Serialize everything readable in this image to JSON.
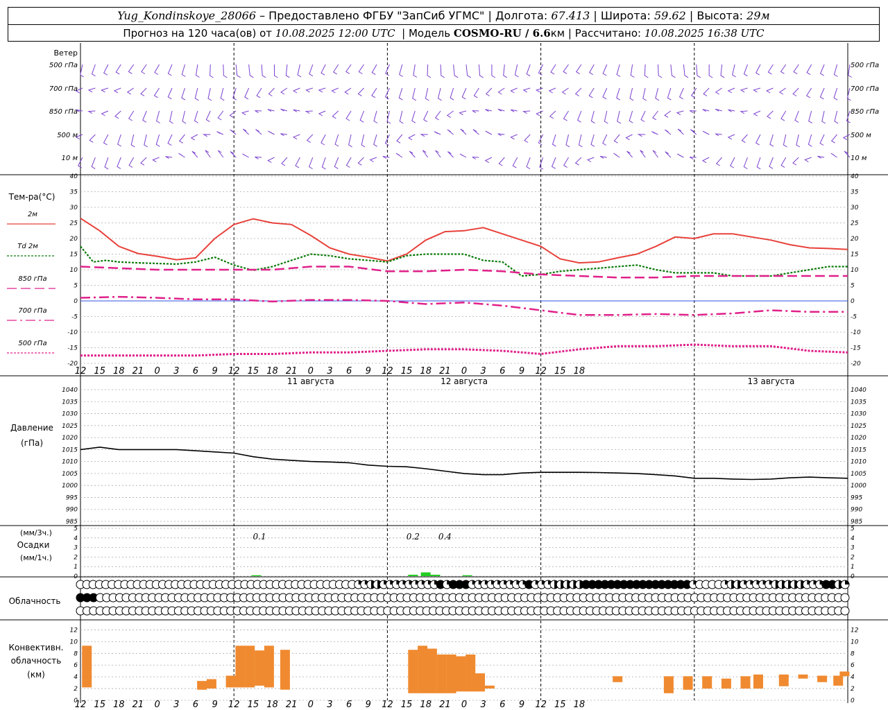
{
  "header": {
    "station": "Yug_Kondinskoye_28066",
    "provider": "– Предоставлено ФГБУ \"ЗапСиб УГМС\"",
    "lon_label": "Долгота:",
    "lon": "67.413",
    "lat_label": "Широта:",
    "lat": "59.62",
    "alt_label": "Высота:",
    "alt": "29м",
    "forecast_label": "Прогноз на 120 часа(ов) от",
    "forecast_start": "10.08.2025 12:00 UTC",
    "model_label": "Модель",
    "model": "COSMO-RU / 6.6",
    "model_unit": "км",
    "calc_label": "Рассчитано:",
    "calc_time": "10.08.2025 16:38 UTC"
  },
  "colors": {
    "wind": "#7a3fd0",
    "t2m": "#e8413a",
    "td2m": "#0a7a0a",
    "t850": "#e0208a",
    "t700": "#e0208a",
    "t500": "#e0208a",
    "precip": "#22cc22",
    "conv": "#f08a30",
    "pressure": "#000000"
  },
  "labels": {
    "wind_title": "Ветер",
    "wind_levels": [
      "500 гПа",
      "700 гПа",
      "850 гПа",
      "500 м",
      "10  м"
    ],
    "temp_title": "Тем-ра(°C)",
    "legend": [
      {
        "label": "2м"
      },
      {
        "label": "Td  2м"
      },
      {
        "label": "850 гПа"
      },
      {
        "label": "700 гПа"
      },
      {
        "label": "500 гПа"
      }
    ],
    "pressure_title": "Давление",
    "pressure_unit": "(гПа)",
    "precip_unit1": "(мм/3ч.)",
    "precip_title": "Осадки",
    "precip_unit2": "(мм/1ч.)",
    "cloud_title": "Облачность",
    "conv_title1": "Конвективн.",
    "conv_title2": "облачность",
    "conv_unit": "(км)"
  },
  "chart_data": {
    "type": "line",
    "x_hours": [
      12,
      15,
      18,
      21,
      0,
      3,
      6,
      9,
      12,
      15,
      18,
      21,
      0,
      3,
      6,
      9,
      12,
      15,
      18,
      21,
      0,
      3,
      6,
      9,
      12,
      15,
      18
    ],
    "dates": [
      "11 августа",
      "12 августа",
      "13 августа"
    ],
    "temperature": {
      "ylim": [
        -20,
        40
      ],
      "ticks": [
        40,
        35,
        30,
        25,
        20,
        15,
        10,
        5,
        0,
        -5,
        -10,
        -15,
        -20
      ],
      "series": [
        {
          "name": "2м",
          "x": [
            0,
            3,
            6,
            9,
            12,
            15,
            18,
            21,
            24,
            27,
            30,
            33,
            36,
            39,
            42,
            45,
            48,
            51,
            54,
            57,
            60,
            63,
            66,
            69,
            72,
            75,
            78,
            81,
            84,
            87,
            90,
            93,
            96,
            99,
            102,
            105,
            108,
            111,
            114,
            117,
            120
          ],
          "values": [
            26.5,
            22.5,
            17.5,
            15.2,
            14.3,
            13.2,
            13.8,
            20,
            24.5,
            26.3,
            25,
            24.5,
            21,
            17,
            15,
            14,
            12.8,
            15,
            19.5,
            22.2,
            22.5,
            23.5,
            21.5,
            19.5,
            17.5,
            13.5,
            12.2,
            12.5,
            13.8,
            15,
            17.5,
            20.5,
            20,
            21.5,
            21.5,
            20.5,
            19.5,
            18,
            17,
            16.8,
            16.5
          ]
        },
        {
          "name": "Td  2м",
          "x": [
            0,
            2,
            4,
            6,
            9,
            12,
            15,
            18,
            21,
            24,
            27,
            30,
            33,
            36,
            39,
            42,
            45,
            48,
            51,
            54,
            57,
            60,
            63,
            66,
            69,
            72,
            75,
            78,
            81,
            84,
            87,
            90,
            93,
            96,
            99,
            102,
            105,
            108,
            111,
            114,
            117,
            120
          ],
          "values": [
            17.5,
            12.5,
            13,
            12.5,
            12.2,
            12,
            11.8,
            12.5,
            14,
            11.5,
            9.8,
            11,
            13,
            15,
            14.5,
            13.5,
            13,
            12.5,
            14.5,
            15,
            15,
            15,
            13,
            12.5,
            8,
            8.5,
            9.5,
            10,
            10.5,
            11,
            11.5,
            10,
            9,
            9,
            9,
            8,
            8,
            8,
            9,
            10,
            11,
            11
          ]
        },
        {
          "name": "850 гПа",
          "x": [
            0,
            6,
            12,
            18,
            24,
            30,
            36,
            42,
            48,
            54,
            60,
            66,
            72,
            78,
            84,
            90,
            96,
            102,
            108,
            114,
            120
          ],
          "values": [
            11,
            10.5,
            10,
            10,
            10,
            10,
            11,
            11,
            9.5,
            9.5,
            10,
            9.5,
            8.5,
            8,
            7.5,
            7.5,
            8,
            8,
            8,
            8,
            8
          ]
        },
        {
          "name": "700 гПа",
          "x": [
            0,
            6,
            12,
            18,
            24,
            30,
            36,
            42,
            48,
            54,
            60,
            66,
            72,
            78,
            84,
            90,
            96,
            102,
            108,
            114,
            120
          ],
          "values": [
            1,
            1.3,
            1,
            0.5,
            0.5,
            -0.2,
            0.3,
            0.3,
            0,
            -1,
            -0.5,
            -1.5,
            -3,
            -4.5,
            -4.5,
            -4.2,
            -4.5,
            -4,
            -3,
            -3.5,
            -3.5
          ]
        },
        {
          "name": "500 гПа",
          "x": [
            0,
            6,
            12,
            18,
            24,
            30,
            36,
            42,
            48,
            54,
            60,
            66,
            72,
            78,
            84,
            90,
            96,
            102,
            108,
            114,
            120
          ],
          "values": [
            -17.5,
            -17.5,
            -17.5,
            -17.5,
            -17,
            -17,
            -16.5,
            -16.5,
            -16,
            -15.5,
            -15.5,
            -16,
            -17,
            -15.5,
            -14.5,
            -14.5,
            -14,
            -14.5,
            -14.5,
            -16,
            -16.5
          ]
        }
      ]
    },
    "pressure": {
      "ylim": [
        985,
        1040
      ],
      "ticks": [
        1040,
        1035,
        1030,
        1025,
        1020,
        1015,
        1010,
        1005,
        1000,
        995,
        990,
        985
      ],
      "x": [
        0,
        3,
        6,
        9,
        12,
        15,
        18,
        21,
        24,
        27,
        30,
        33,
        36,
        39,
        42,
        45,
        48,
        51,
        54,
        57,
        60,
        63,
        66,
        69,
        72,
        75,
        78,
        81,
        84,
        87,
        90,
        93,
        96,
        99,
        102,
        105,
        108,
        111,
        114,
        117,
        120
      ],
      "values": [
        1015,
        1016,
        1015,
        1015,
        1015,
        1015,
        1014.5,
        1014,
        1013.5,
        1012,
        1011,
        1010.5,
        1010,
        1009.8,
        1009.5,
        1008.5,
        1008,
        1007.8,
        1007,
        1006,
        1005,
        1004.5,
        1004.5,
        1005.2,
        1005.5,
        1005.5,
        1005.5,
        1005.4,
        1005.2,
        1005,
        1004.5,
        1004,
        1003,
        1003,
        1002.7,
        1002.5,
        1002.7,
        1003.2,
        1003.5,
        1003.2,
        1003
      ]
    },
    "precip": {
      "ylim": [
        0,
        5
      ],
      "ticks": [
        5,
        4,
        3,
        2,
        1,
        0
      ],
      "labels": [
        {
          "x": 28,
          "text": "0.1"
        },
        {
          "x": 52,
          "text": "0.2"
        },
        {
          "x": 57,
          "text": "0.4"
        }
      ],
      "bars": [
        {
          "x": 27.5,
          "value": 0.1
        },
        {
          "x": 52,
          "value": 0.15
        },
        {
          "x": 54,
          "value": 0.4
        },
        {
          "x": 55.5,
          "value": 0.15
        },
        {
          "x": 60.5,
          "value": 0.1
        }
      ]
    },
    "cloud_rows": [
      "OOOOOOOOOOOOOOOOOOOOOOOOOOOOOOOOOOOOOOOOOOOOQQTTQQQQQQQQQHQHHHQQQQQQQQQHQQQTTTTTHHHHHHHHHHHHHHHHHQOOOOQTTQQQQQTTTTTQQQHHTQ",
      "HHHOOOOOOOOOOOOOOOOOOOOOOOOOOOOOOOOOOOOOOOOOOOOOOOOOOOOOOOOOOOOOOOOOOOOOOOOOOOOOOOOOOOOOOOOOOOOOOOOOOOOOOOOOOOOOOOOOOO",
      "OOOOOOOOOOOOOOOOOOOOOOOOOOOOOOOOOOOOOOOOOOOOOOOOOOOOOOOOOOOOOOOOOOOOOOOOOOOOOOOOOOOOOOOOOOOOOOOOOOOOOOOOOOOOOOOOOOOOOO"
    ],
    "convective": {
      "ylim": [
        0,
        13
      ],
      "ticks": [
        12,
        10,
        8,
        6,
        4,
        2,
        0
      ],
      "bars": [
        {
          "x": 1,
          "base": 2.2,
          "top": 9.3
        },
        {
          "x": 19,
          "base": 1.8,
          "top": 3.3
        },
        {
          "x": 20.5,
          "base": 2.0,
          "top": 3.6
        },
        {
          "x": 23.5,
          "base": 2.2,
          "top": 4.2
        },
        {
          "x": 25,
          "base": 2.2,
          "top": 9.3
        },
        {
          "x": 26.5,
          "base": 2.2,
          "top": 9.3
        },
        {
          "x": 28,
          "base": 2.5,
          "top": 8.5
        },
        {
          "x": 29.5,
          "base": 2.2,
          "top": 9.3
        },
        {
          "x": 32,
          "base": 1.8,
          "top": 8.6
        },
        {
          "x": 52,
          "base": 1.2,
          "top": 8.6
        },
        {
          "x": 53.5,
          "base": 1.2,
          "top": 9.3
        },
        {
          "x": 55,
          "base": 1.2,
          "top": 8.8
        },
        {
          "x": 56.5,
          "base": 1.2,
          "top": 7.8
        },
        {
          "x": 58,
          "base": 1.2,
          "top": 7.8
        },
        {
          "x": 59.5,
          "base": 1.5,
          "top": 7.5
        },
        {
          "x": 61,
          "base": 1.5,
          "top": 7.8
        },
        {
          "x": 62.5,
          "base": 1.5,
          "top": 4.6
        },
        {
          "x": 64,
          "base": 2.0,
          "top": 2.5
        },
        {
          "x": 84,
          "base": 3.1,
          "top": 4.1
        },
        {
          "x": 92,
          "base": 1.2,
          "top": 4.1
        },
        {
          "x": 95,
          "base": 1.8,
          "top": 4.1
        },
        {
          "x": 98,
          "base": 2.0,
          "top": 4.1
        },
        {
          "x": 101,
          "base": 2.0,
          "top": 3.7
        },
        {
          "x": 104,
          "base": 2.0,
          "top": 4.1
        },
        {
          "x": 106,
          "base": 2.0,
          "top": 4.4
        },
        {
          "x": 110,
          "base": 2.4,
          "top": 4.4
        },
        {
          "x": 113,
          "base": 3.7,
          "top": 4.4
        },
        {
          "x": 116,
          "base": 3.1,
          "top": 4.2
        },
        {
          "x": 118.5,
          "base": 2.5,
          "top": 4.2
        },
        {
          "x": 119.5,
          "base": 4.1,
          "top": 4.9
        }
      ]
    }
  }
}
